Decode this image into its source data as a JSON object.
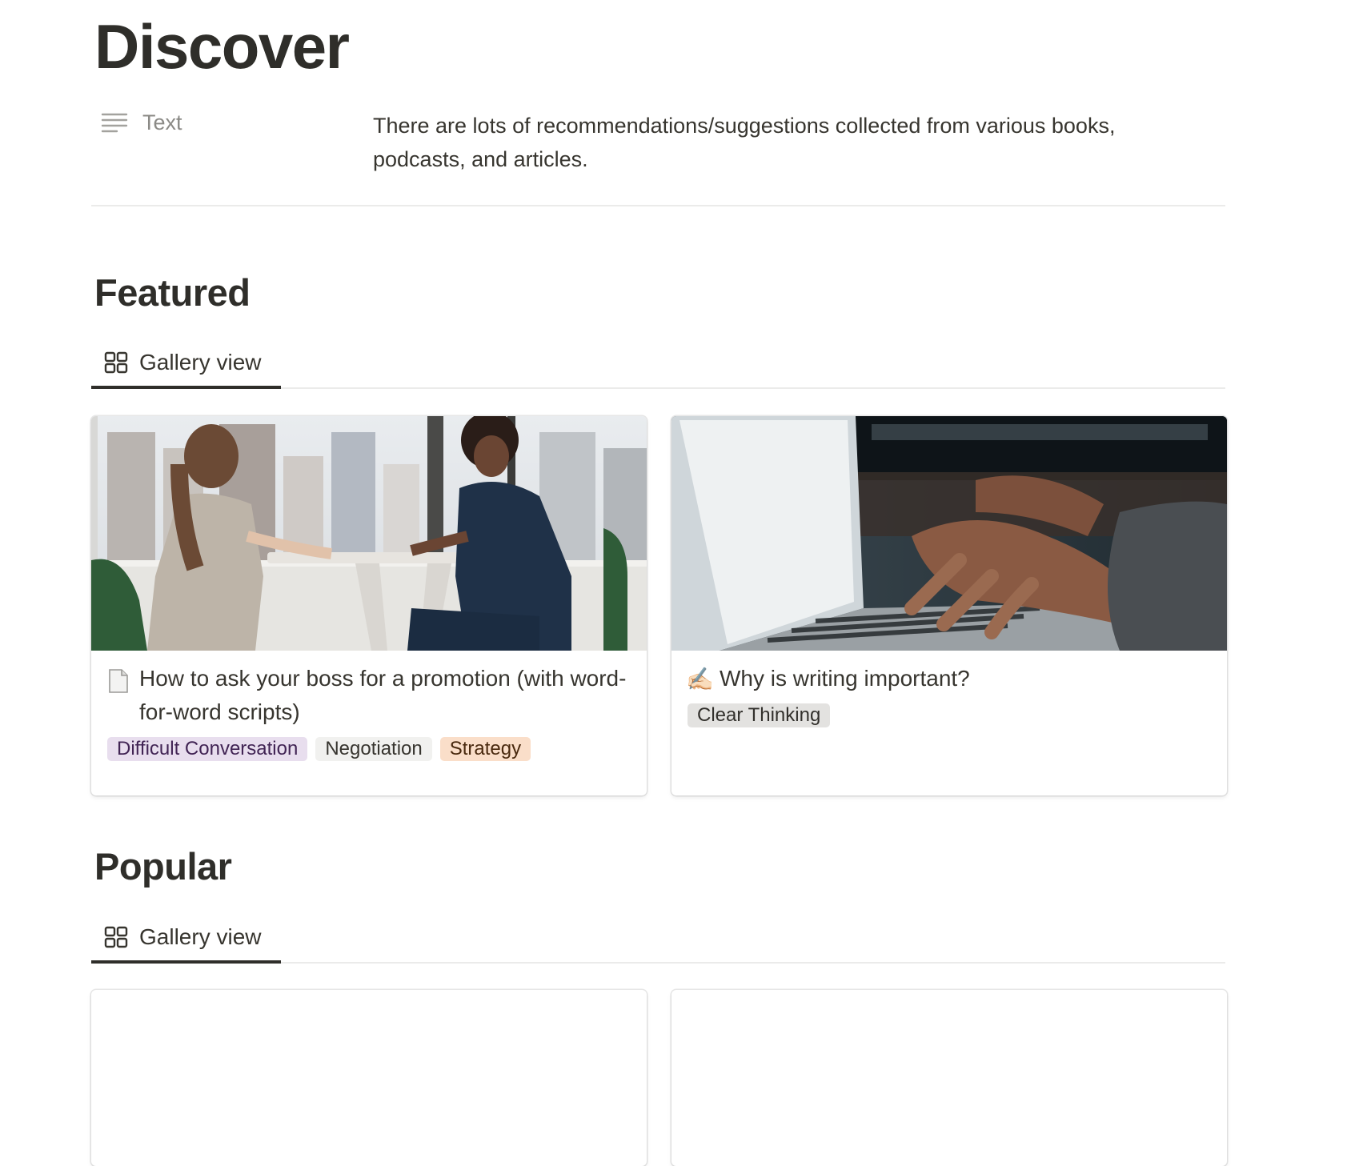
{
  "page": {
    "title": "Discover"
  },
  "property": {
    "icon": "text-lines-icon",
    "name": "Text",
    "value": "There are lots of recommendations/suggestions collected from various books, podcasts, and articles."
  },
  "sections": [
    {
      "title": "Featured",
      "view": {
        "icon": "gallery-grid-icon",
        "label": "Gallery view"
      },
      "cards": [
        {
          "title": "How to ask your boss for a promotion (with word-for-word scripts)",
          "icon": "document-page-icon",
          "cover": "two-women-talking-at-table-photo",
          "tags": [
            {
              "label": "Difficult Conversation",
              "color": "#e8deee"
            },
            {
              "label": "Negotiation",
              "color": "#f1f1ef"
            },
            {
              "label": "Strategy",
              "color": "#fadec9"
            }
          ]
        },
        {
          "title": "Why is writing important?",
          "icon": "writing-hand-icon",
          "emoji": "✍🏻",
          "cover": "hands-typing-on-laptop-photo",
          "tags": [
            {
              "label": "Clear Thinking",
              "color": "#e3e2e0"
            }
          ]
        }
      ]
    },
    {
      "title": "Popular",
      "view": {
        "icon": "gallery-grid-icon",
        "label": "Gallery view"
      },
      "cards": [
        {
          "title": "",
          "tags": []
        },
        {
          "title": "",
          "tags": []
        }
      ]
    }
  ],
  "colors": {
    "text": "#37352f",
    "muted": "#8b8a86",
    "divider": "#ebebea"
  }
}
